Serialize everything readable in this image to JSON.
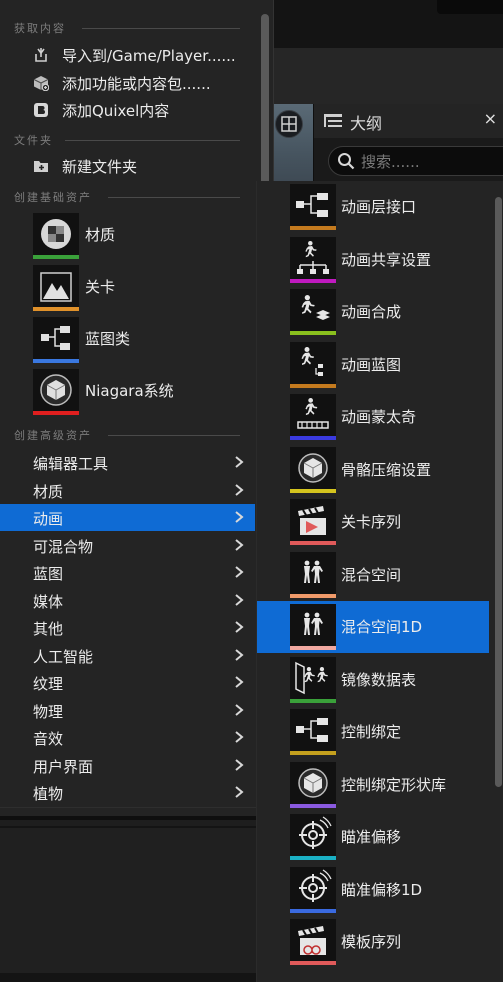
{
  "background": {
    "outliner": {
      "title": "大纲",
      "search_placeholder": "搜索......",
      "close_label": "×"
    }
  },
  "menu": {
    "sections": {
      "get_content": "获取内容",
      "folder": "文件夹",
      "basic_assets": "创建基础资产",
      "advanced_assets": "创建高级资产"
    },
    "get_content_items": [
      {
        "label": "导入到/Game/Player......",
        "icon": "import-icon"
      },
      {
        "label": "添加功能或内容包......",
        "icon": "content-pack-icon"
      },
      {
        "label": "添加Quixel内容",
        "icon": "quixel-bridge-icon"
      }
    ],
    "folder_items": [
      {
        "label": "新建文件夹",
        "icon": "new-folder-icon"
      }
    ],
    "basic_assets": [
      {
        "label": "材质",
        "icon": "material-icon",
        "bar_color": "#3aa13a"
      },
      {
        "label": "关卡",
        "icon": "level-icon",
        "bar_color": "#e0912a"
      },
      {
        "label": "蓝图类",
        "icon": "blueprint-class-icon",
        "bar_color": "#3a78e0"
      },
      {
        "label": "Niagara系统",
        "icon": "niagara-system-icon",
        "bar_color": "#e01f1f"
      }
    ],
    "advanced_assets": [
      {
        "label": "编辑器工具"
      },
      {
        "label": "材质"
      },
      {
        "label": "动画",
        "selected": true
      },
      {
        "label": "可混合物"
      },
      {
        "label": "蓝图"
      },
      {
        "label": "媒体"
      },
      {
        "label": "其他"
      },
      {
        "label": "人工智能"
      },
      {
        "label": "纹理"
      },
      {
        "label": "物理"
      },
      {
        "label": "音效"
      },
      {
        "label": "用户界面"
      },
      {
        "label": "植物"
      }
    ]
  },
  "submenu": {
    "items": [
      {
        "label": "动画层接口",
        "icon": "anim-layer-interface-icon",
        "bar_color": "#c47a1e"
      },
      {
        "label": "动画共享设置",
        "icon": "anim-sharing-setup-icon",
        "bar_color": "#c01ac0"
      },
      {
        "label": "动画合成",
        "icon": "anim-composite-icon",
        "bar_color": "#8ac01e"
      },
      {
        "label": "动画蓝图",
        "icon": "anim-blueprint-icon",
        "bar_color": "#c47a1e"
      },
      {
        "label": "动画蒙太奇",
        "icon": "anim-montage-icon",
        "bar_color": "#3a3ae0"
      },
      {
        "label": "骨骼压缩设置",
        "icon": "bone-compression-icon",
        "bar_color": "#d4c41e"
      },
      {
        "label": "关卡序列",
        "icon": "level-sequence-icon",
        "bar_color": "#e05a5a"
      },
      {
        "label": "混合空间",
        "icon": "blend-space-icon",
        "bar_color": "#f09a6a"
      },
      {
        "label": "混合空间1D",
        "icon": "blend-space-1d-icon",
        "bar_color": "#f0a8a0",
        "selected": true
      },
      {
        "label": "镜像数据表",
        "icon": "mirror-data-table-icon",
        "bar_color": "#3aa13a"
      },
      {
        "label": "控制绑定",
        "icon": "control-rig-icon",
        "bar_color": "#c4a01e"
      },
      {
        "label": "控制绑定形状库",
        "icon": "control-rig-shape-library-icon",
        "bar_color": "#8a5ae0"
      },
      {
        "label": "瞄准偏移",
        "icon": "aim-offset-icon",
        "bar_color": "#1ab0c4"
      },
      {
        "label": "瞄准偏移1D",
        "icon": "aim-offset-1d-icon",
        "bar_color": "#3a6ae0"
      },
      {
        "label": "模板序列",
        "icon": "template-sequence-icon",
        "bar_color": "#e05a5a"
      }
    ]
  }
}
